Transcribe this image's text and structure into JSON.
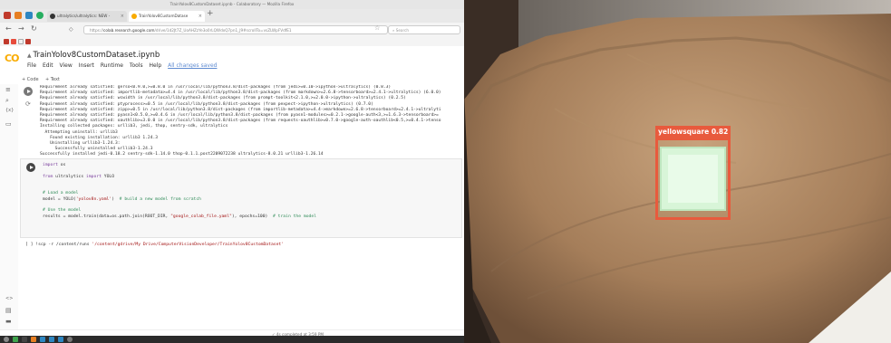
{
  "window": {
    "title": "TrainYolov8CustomDataset.ipynb - Colaboratory — Mozilla Firefox"
  },
  "tabs": [
    {
      "label": "ultralytics/ultralytics: NEW - ",
      "active": false
    },
    {
      "label": "TrainYolov8CustomDatase",
      "active": true
    }
  ],
  "navbar": {
    "url_prefix": "https://",
    "url_host": "colab.research.google.com",
    "url_rest": "/drive/1d2Jt7Z_UoAHZzYe3o0rLQWdxQ7pn1_J9#scrollTo=vsZLWpFVdfE1",
    "search_placeholder": "Search"
  },
  "notebook": {
    "title": "TrainYolov8CustomDataset.ipynb",
    "menu": [
      "File",
      "Edit",
      "View",
      "Insert",
      "Runtime",
      "Tools",
      "Help"
    ],
    "saved_status": "All changes saved",
    "toolbar": [
      "+ Code",
      "+ Text"
    ]
  },
  "output_lines": [
    "Requirement already satisfied: gerso<0.9.0,>=0.8.0 in /usr/local/lib/python3.8/dist-packages (from jedi>=0.10->ipython->ultralytics) (0.8.3)",
    "Requirement already satisfied: importlib-metadata>=4.4 in /usr/local/lib/python3.8/dist-packages (from markdown>=2.6.8->tensorboard>=2.4.1->ultralytics) (6.0.0)",
    "Requirement already satisfied: wcwidth in /usr/local/lib/python3.8/dist-packages (from prompt-toolkit<2.1.0,>=2.0.0->ipython->ultralytics) (0.2.5)",
    "Requirement already satisfied: ptyprocess>=0.5 in /usr/local/lib/python3.8/dist-packages (from pexpect->ipython->ultralytics) (0.7.0)",
    "Requirement already satisfied: zipp>=0.5 in /usr/local/lib/python3.8/dist-packages (from importlib-metadata>=4.4->markdown>=2.6.8->tensorboard>=2.4.1->ultralyti",
    "Requirement already satisfied: pyasn1<0.5.0,>=0.4.6 in /usr/local/lib/python3.8/dist-packages (from pyasn1-modules>=0.2.1->google-auth<3,>=1.6.3->tensorboard>=",
    "Requirement already satisfied: oauthlib>=3.0.0 in /usr/local/lib/python3.8/dist-packages (from requests-oauthlib>=0.7.0->google-auth-oauthlib<0.5,>=0.4.1->tenso",
    "Installing collected packages: urllib3, jedi, thop, sentry-sdk, ultralytics",
    "  Attempting uninstall: urllib3",
    "    Found existing installation: urllib3 1.24.3",
    "    Uninstalling urllib3-1.24.3:",
    "      Successfully uninstalled urllib3-1.24.3",
    "Successfully installed jedi-0.18.2 sentry-sdk-1.14.0 thop-0.1.1.post2209072238 ultralytics-8.0.21 urllib3-1.26.14"
  ],
  "code": {
    "l1a": "import",
    "l1b": " os",
    "l2a": "from",
    "l2b": " ultralytics ",
    "l2c": "import",
    "l2d": " YOLO",
    "l3": "# Load a model",
    "l4a": "model = YOLO(",
    "l4b": "'yolov8n.yaml'",
    "l4c": ")  ",
    "l4d": "# build a new model from scratch",
    "l5": "# Use the model",
    "l6a": "results = model.train(data=os.path.join(ROOT_DIR, ",
    "l6b": "\"google_colab_file.yaml\"",
    "l6c": "), epochs=",
    "l6d": "100",
    "l6e": ")  ",
    "l6f": "# train the model"
  },
  "cell2": {
    "prefix": "[ ]",
    "cmd": "!scp -r /content/runs ",
    "path": "'/content/gdrive/My Drive/ComputerVisionDeveloper/TrainYolov8CustomDataset'"
  },
  "status": {
    "text": "✓ 4s   completed at 3:59 PM"
  },
  "detection": {
    "label": "yellowsquare",
    "confidence": "0.82"
  },
  "colors": {
    "accent": "#e85a3d",
    "colab_orange": "#f9ab00",
    "link": "#5f8bd1"
  }
}
